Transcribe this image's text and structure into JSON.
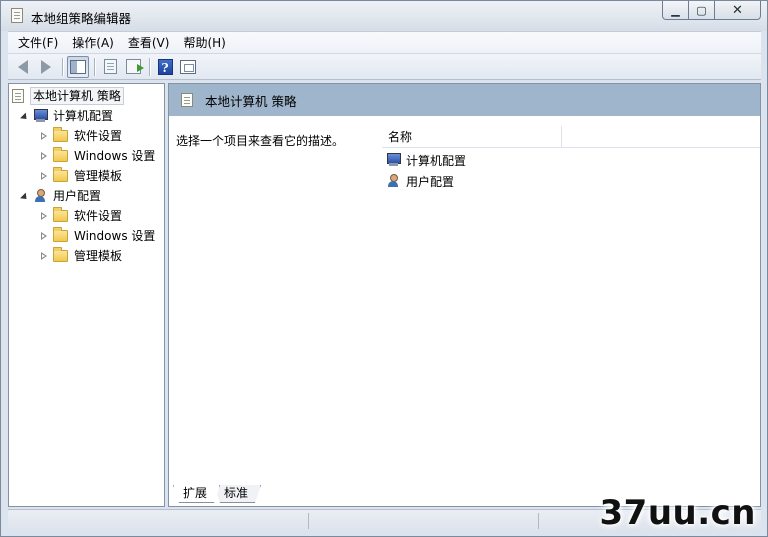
{
  "window": {
    "title": "本地组策略编辑器",
    "caption_buttons": {
      "minimize": "▁",
      "maximize": "▢",
      "close": "✕"
    }
  },
  "menu": [
    {
      "label": "文件(F)"
    },
    {
      "label": "操作(A)"
    },
    {
      "label": "查看(V)"
    },
    {
      "label": "帮助(H)"
    }
  ],
  "toolbar": {
    "buttons": [
      {
        "icon": "back-arrow-icon"
      },
      {
        "icon": "forward-arrow-icon"
      },
      {
        "icon": "show-hide-tree-icon"
      },
      {
        "icon": "properties-icon"
      },
      {
        "icon": "export-list-icon"
      },
      {
        "icon": "help-icon",
        "glyph": "?"
      },
      {
        "icon": "show-hide-action-pane-icon"
      }
    ]
  },
  "tree": {
    "root": "本地计算机 策略",
    "nodes": [
      {
        "label": "计算机配置",
        "children": [
          "软件设置",
          "Windows 设置",
          "管理模板"
        ]
      },
      {
        "label": "用户配置",
        "children": [
          "软件设置",
          "Windows 设置",
          "管理模板"
        ]
      }
    ]
  },
  "details": {
    "header": "本地计算机 策略",
    "description": "选择一个项目来查看它的描述。",
    "column_name": "名称",
    "items": [
      {
        "label": "计算机配置",
        "icon": "computer-icon"
      },
      {
        "label": "用户配置",
        "icon": "user-icon"
      }
    ],
    "tabs": [
      "扩展",
      "标准"
    ]
  },
  "watermark": "37uu.cn",
  "colors": {
    "header_band": "#9fb5cc",
    "window_frame": "#dbe3ee",
    "folder": "#f2c94c"
  }
}
